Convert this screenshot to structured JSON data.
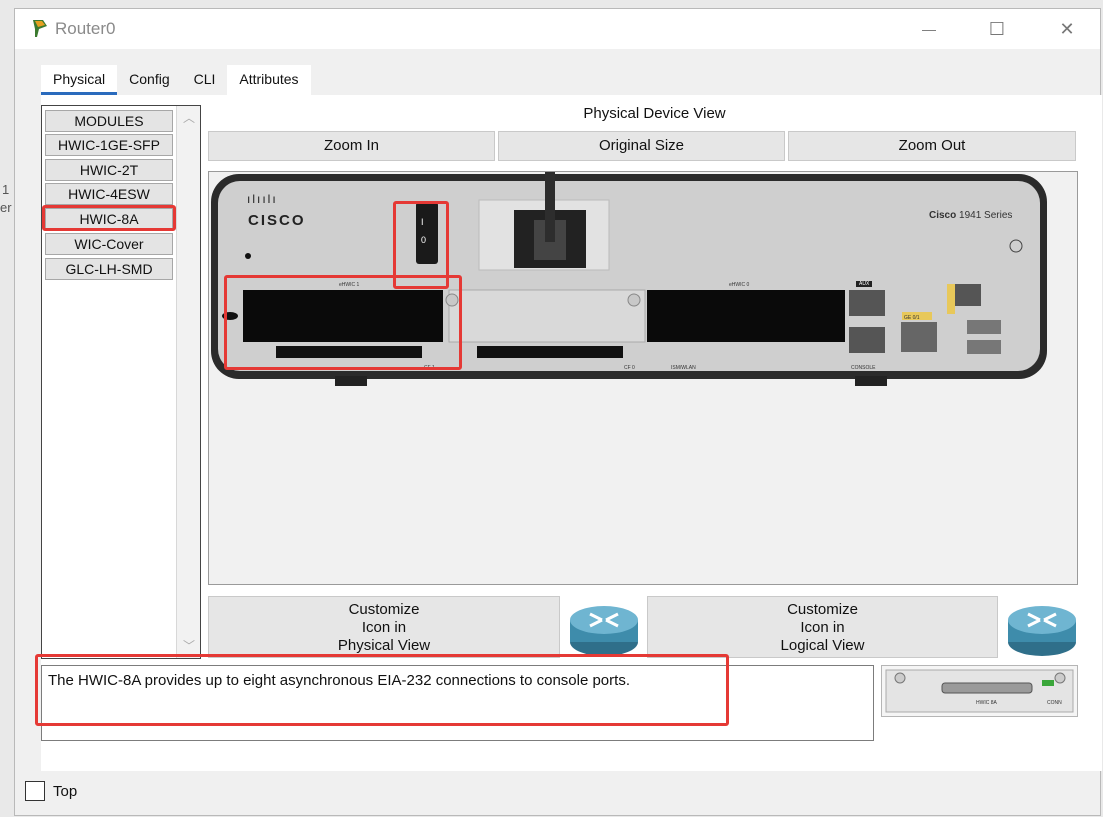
{
  "window": {
    "title": "Router0",
    "minimize": "—",
    "maximize": "☐",
    "close": "✕"
  },
  "tabs": [
    {
      "label": "Physical",
      "active": true
    },
    {
      "label": "Config",
      "active": false
    },
    {
      "label": "CLI",
      "active": false
    },
    {
      "label": "Attributes",
      "active": false
    }
  ],
  "modules": {
    "items": [
      "MODULES",
      "HWIC-1GE-SFP",
      "HWIC-2T",
      "HWIC-4ESW",
      "HWIC-8A",
      "WIC-Cover",
      "GLC-LH-SMD"
    ],
    "selected": "HWIC-8A"
  },
  "device_view": {
    "label": "Physical Device View",
    "zoom_in": "Zoom In",
    "original_size": "Original Size",
    "zoom_out": "Zoom Out"
  },
  "router": {
    "brand": "cisco",
    "series_prefix": "Cisco",
    "series_num": "1941 Series",
    "slot1_label": "eHWIC 1",
    "slot0_label": "eHWIC 0",
    "aux_label": "AUX",
    "console_label": "CONSOLE",
    "cf1_label": "CF 1",
    "cf0_label": "CF 0",
    "isminlan_label": "ISM/WLAN",
    "ge_label": "GE 0/1",
    "power_on": "I",
    "power_off": "0"
  },
  "customize": {
    "physical_lines": [
      "Customize",
      "Icon in",
      "Physical View"
    ],
    "logical_lines": [
      "Customize",
      "Icon in",
      "Logical View"
    ]
  },
  "description": "The HWIC-8A provides up to eight asynchronous EIA-232 connections to console ports.",
  "thumb": {
    "label": "HWIC 8A",
    "conn": "CONN"
  },
  "bottom": {
    "top_label": "Top"
  },
  "side": {
    "a": "1",
    "b": "er"
  },
  "colors": {
    "highlight": "#e53935",
    "tab_accent": "#2a6bbd"
  }
}
